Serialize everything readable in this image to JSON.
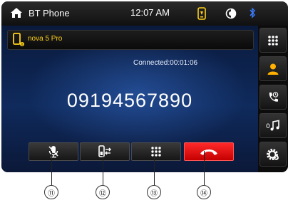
{
  "statusbar": {
    "title": "BT Phone",
    "time": "12:07 AM",
    "icons": [
      "home-icon",
      "phone-status-icon",
      "brightness-icon",
      "bluetooth-icon"
    ]
  },
  "device": {
    "name": "nova 5 Pro",
    "icon": "mobile-phone-icon"
  },
  "call": {
    "status": "Connected:00:01:06",
    "number": "09194567890"
  },
  "controls": [
    {
      "id": "mute",
      "icon": "mic-mute-icon"
    },
    {
      "id": "transfer",
      "icon": "voice-transfer-icon"
    },
    {
      "id": "keypad",
      "icon": "keypad-icon"
    },
    {
      "id": "end-call",
      "icon": "hang-up-icon"
    }
  ],
  "sidebar": [
    {
      "id": "dial",
      "icon": "dialpad-icon"
    },
    {
      "id": "contacts",
      "icon": "contacts-icon"
    },
    {
      "id": "call-log",
      "icon": "call-log-icon"
    },
    {
      "id": "music",
      "icon": "music-icon"
    },
    {
      "id": "settings",
      "icon": "settings-icon"
    }
  ],
  "callouts": [
    "⑪",
    "⑫",
    "⑬",
    "⑭"
  ],
  "colors": {
    "accent": "#ffd21a",
    "bluetooth": "#3a7bff",
    "end_call": "#e00000",
    "background": "#0f2a5c"
  }
}
